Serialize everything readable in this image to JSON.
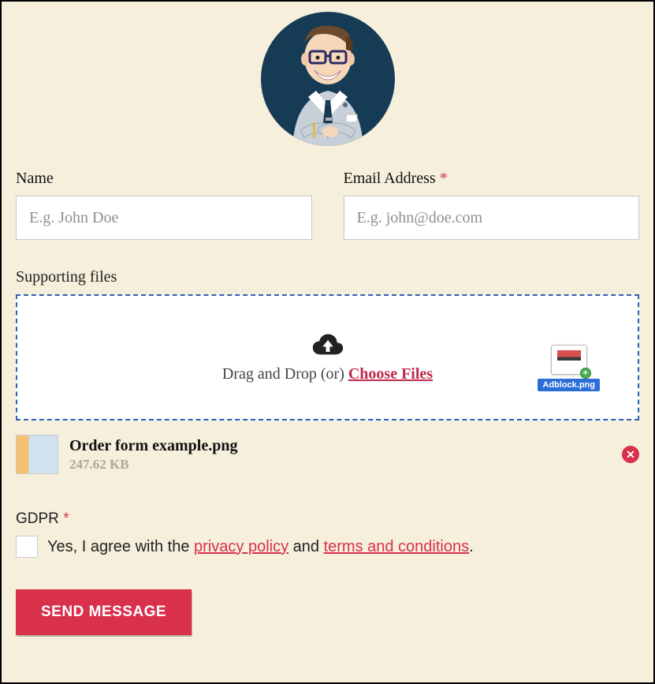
{
  "form": {
    "name_label": "Name",
    "name_placeholder": "E.g. John Doe",
    "email_label": "Email Address",
    "email_placeholder": "E.g. john@doe.com",
    "files_label": "Supporting files",
    "dropzone_text_prefix": "Drag and Drop (or) ",
    "choose_files_label": "Choose Files",
    "dragged_file_name": "Adblock.png",
    "uploaded_file": {
      "name": "Order form example.png",
      "size": "247.62 KB"
    },
    "gdpr_label": "GDPR",
    "gdpr_text_1": "Yes, I agree with the ",
    "gdpr_link_privacy": "privacy policy",
    "gdpr_text_2": " and ",
    "gdpr_link_terms": "terms and conditions",
    "gdpr_text_3": ".",
    "submit_label": "SEND MESSAGE",
    "required_marker": "*"
  }
}
